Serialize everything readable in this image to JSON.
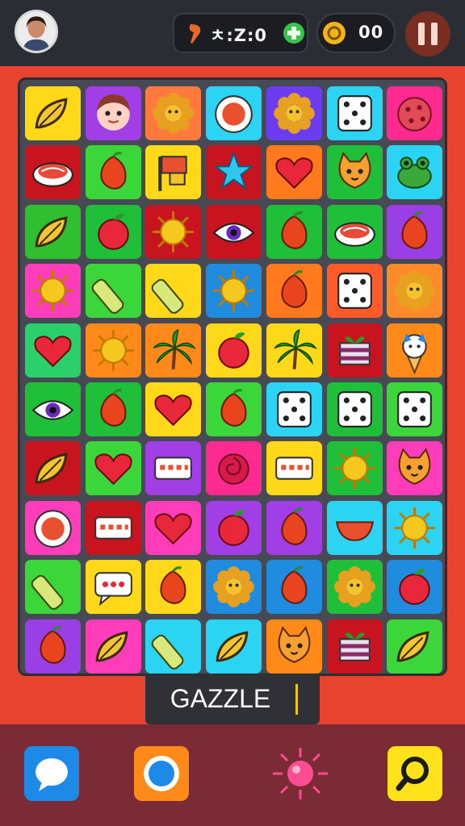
{
  "header": {
    "score_text": "ㅊ:Z:0",
    "coins_text": "00",
    "icons": [
      "avatar",
      "torch-icon",
      "plus-icon",
      "coin-icon",
      "pause-icon"
    ],
    "colors": {
      "bar": "#2a2d33",
      "plus": "#37c24a",
      "coin": "#f2b515",
      "pause": "#7a2e22"
    }
  },
  "game": {
    "title": "GAZZLE"
  },
  "board": {
    "rows": 10,
    "cols": 7,
    "tiles": [
      [
        [
          "#ffd81a",
          "leaf"
        ],
        [
          "#a23ee6",
          "face"
        ],
        [
          "#ff7a3c",
          "flower"
        ],
        [
          "#2bd4f2",
          "ring"
        ],
        [
          "#6c3df0",
          "flower"
        ],
        [
          "#2bd4f2",
          "dice"
        ],
        [
          "#ff2a8f",
          "cookie"
        ]
      ],
      [
        [
          "#c8141e",
          "sushi"
        ],
        [
          "#3ad63a",
          "fruit"
        ],
        [
          "#ffd81a",
          "flag"
        ],
        [
          "#c8141e",
          "star"
        ],
        [
          "#ff7a1c",
          "heart"
        ],
        [
          "#1fbf3a",
          "cat"
        ],
        [
          "#2bd4f2",
          "frog"
        ]
      ],
      [
        [
          "#2fbf2f",
          "leaf"
        ],
        [
          "#1fbf3a",
          "apple"
        ],
        [
          "#c8141e",
          "sun"
        ],
        [
          "#c8141e",
          "eye"
        ],
        [
          "#1fbf3a",
          "fruit"
        ],
        [
          "#1fbf3a",
          "sushi"
        ],
        [
          "#9a3ee6",
          "fruit"
        ]
      ],
      [
        [
          "#ff3dbb",
          "sun"
        ],
        [
          "#3ad63a",
          "log"
        ],
        [
          "#ffd81a",
          "log"
        ],
        [
          "#1f8ce0",
          "sun"
        ],
        [
          "#ff7a1c",
          "fruit"
        ],
        [
          "#ff5a28",
          "dice"
        ],
        [
          "#ff8a2a",
          "flower"
        ]
      ],
      [
        [
          "#2ad06a",
          "heart"
        ],
        [
          "#ff8a1a",
          "sun"
        ],
        [
          "#ff8a1a",
          "palm"
        ],
        [
          "#ffd81a",
          "apple"
        ],
        [
          "#ffd81a",
          "palm"
        ],
        [
          "#c8141e",
          "gift"
        ],
        [
          "#ff8a1a",
          "icecream"
        ]
      ],
      [
        [
          "#1fbf3a",
          "eye"
        ],
        [
          "#1fbf3a",
          "fruit"
        ],
        [
          "#ffd81a",
          "heart"
        ],
        [
          "#3ad63a",
          "fruit"
        ],
        [
          "#2bd4f2",
          "dice"
        ],
        [
          "#1fbf3a",
          "dice"
        ],
        [
          "#3ad63a",
          "dice"
        ]
      ],
      [
        [
          "#c8141e",
          "leaf"
        ],
        [
          "#3ad63a",
          "heart"
        ],
        [
          "#a23ee6",
          "card"
        ],
        [
          "#ff2a8f",
          "rose"
        ],
        [
          "#ffd81a",
          "card"
        ],
        [
          "#1fbf3a",
          "sun"
        ],
        [
          "#ff3dbb",
          "cat"
        ]
      ],
      [
        [
          "#ff3dbb",
          "ring"
        ],
        [
          "#c8141e",
          "card"
        ],
        [
          "#ff3dbb",
          "heart"
        ],
        [
          "#a23ee6",
          "apple"
        ],
        [
          "#a23ee6",
          "fruit"
        ],
        [
          "#2bd4f2",
          "bowl"
        ],
        [
          "#2bd4f2",
          "sun"
        ]
      ],
      [
        [
          "#3ad63a",
          "log"
        ],
        [
          "#ffd81a",
          "bubble"
        ],
        [
          "#ffd81a",
          "fruit"
        ],
        [
          "#1f8ce0",
          "flower"
        ],
        [
          "#1f8ce0",
          "fruit"
        ],
        [
          "#1fbf3a",
          "flower"
        ],
        [
          "#1f8ce0",
          "apple"
        ]
      ],
      [
        [
          "#9a3ee6",
          "fruit"
        ],
        [
          "#ff3dbb",
          "leaf"
        ],
        [
          "#2bd4f2",
          "log"
        ],
        [
          "#2bd4f2",
          "leaf"
        ],
        [
          "#ff8a1a",
          "cat"
        ],
        [
          "#c8141e",
          "gift"
        ],
        [
          "#3ad63a",
          "leaf"
        ]
      ]
    ]
  },
  "bottom_bar": {
    "buttons": [
      {
        "name": "chat-button",
        "icon": "chat-icon",
        "color": "#1e8ae8"
      },
      {
        "name": "ring-button",
        "icon": "ring-icon",
        "color": "#ff8a1a"
      },
      {
        "name": "burst-button",
        "icon": "burst-icon",
        "color": "#ff4b8f"
      },
      {
        "name": "search-button",
        "icon": "search-icon",
        "color": "#ffe21a"
      }
    ]
  }
}
